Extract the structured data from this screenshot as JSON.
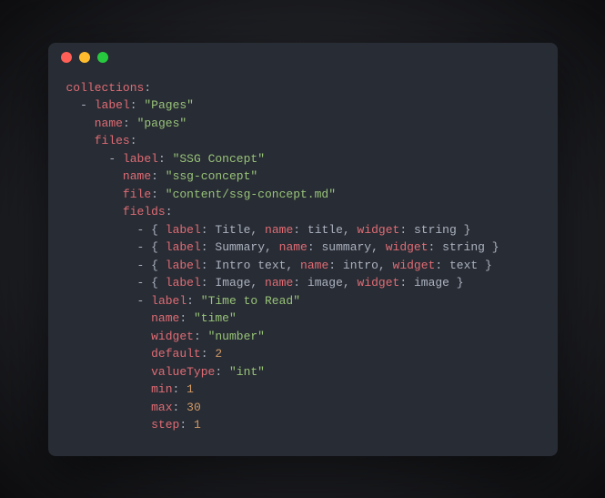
{
  "code": {
    "k_collections": "collections",
    "k_label": "label",
    "k_name": "name",
    "k_files": "files",
    "k_file": "file",
    "k_fields": "fields",
    "k_widget": "widget",
    "k_default": "default",
    "k_valueType": "valueType",
    "k_min": "min",
    "k_max": "max",
    "k_step": "step",
    "v_pages_label": "\"Pages\"",
    "v_pages_name": "\"pages\"",
    "v_ssg_label": "\"SSG Concept\"",
    "v_ssg_name": "\"ssg-concept\"",
    "v_ssg_file": "\"content/ssg-concept.md\"",
    "f1_label": "Title",
    "f1_name": "title",
    "f1_widget": "string",
    "f2_label": "Summary",
    "f2_name": "summary",
    "f2_widget": "string",
    "f3_label": "Intro text",
    "f3_name": "intro",
    "f3_widget": "text",
    "f4_label": "Image",
    "f4_name": "image",
    "f4_widget": "image",
    "f5_label": "\"Time to Read\"",
    "f5_name": "\"time\"",
    "f5_widget": "\"number\"",
    "f5_default": "2",
    "f5_valueType": "\"int\"",
    "f5_min": "1",
    "f5_max": "30",
    "f5_step": "1"
  }
}
